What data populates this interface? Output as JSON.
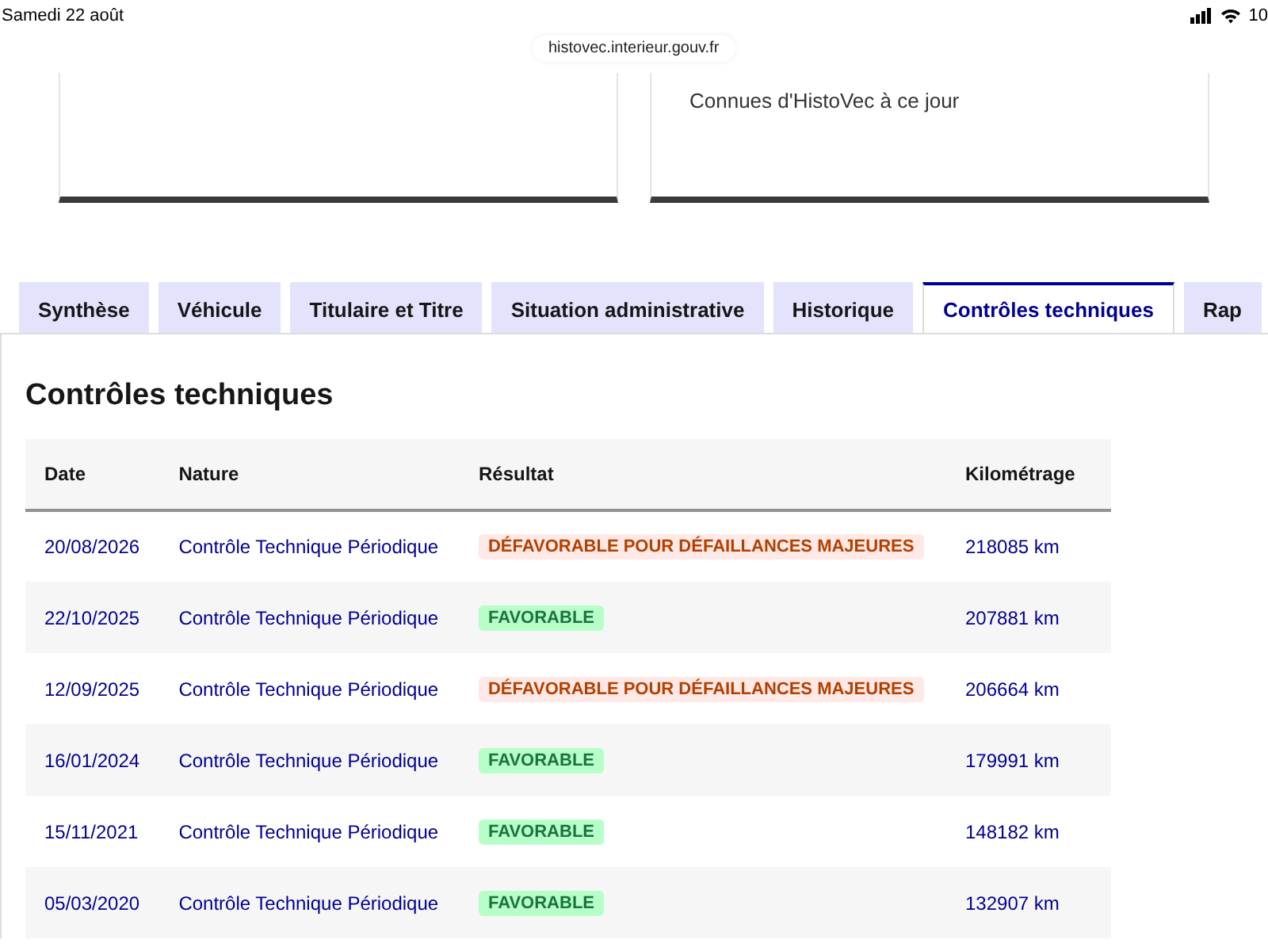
{
  "status_bar": {
    "date": "Samedi 22 août",
    "battery": "10"
  },
  "address_bar": {
    "url": "histovec.interieur.gouv.fr"
  },
  "right_card": {
    "text": "Connues d'HistoVec à ce jour"
  },
  "tabs": [
    {
      "label": "Synthèse",
      "selected": false
    },
    {
      "label": "Véhicule",
      "selected": false
    },
    {
      "label": "Titulaire et Titre",
      "selected": false
    },
    {
      "label": "Situation administrative",
      "selected": false
    },
    {
      "label": "Historique",
      "selected": false
    },
    {
      "label": "Contrôles techniques",
      "selected": true
    },
    {
      "label": "Rap",
      "selected": false
    }
  ],
  "section_title": "Contrôles techniques",
  "table": {
    "columns": [
      "Date",
      "Nature",
      "Résultat",
      "Kilométrage"
    ],
    "rows": [
      {
        "date": "20/08/2026",
        "nature": "Contrôle Technique Périodique",
        "result": {
          "kind": "error",
          "label": "DÉFAVORABLE POUR DÉFAILLANCES MAJEURES"
        },
        "mileage": "218085 km"
      },
      {
        "date": "22/10/2025",
        "nature": "Contrôle Technique Périodique",
        "result": {
          "kind": "success",
          "label": "FAVORABLE"
        },
        "mileage": "207881 km"
      },
      {
        "date": "12/09/2025",
        "nature": "Contrôle Technique Périodique",
        "result": {
          "kind": "error",
          "label": "DÉFAVORABLE POUR DÉFAILLANCES MAJEURES"
        },
        "mileage": "206664 km"
      },
      {
        "date": "16/01/2024",
        "nature": "Contrôle Technique Périodique",
        "result": {
          "kind": "success",
          "label": "FAVORABLE"
        },
        "mileage": "179991 km"
      },
      {
        "date": "15/11/2021",
        "nature": "Contrôle Technique Périodique",
        "result": {
          "kind": "success",
          "label": "FAVORABLE"
        },
        "mileage": "148182 km"
      },
      {
        "date": "05/03/2020",
        "nature": "Contrôle Technique Périodique",
        "result": {
          "kind": "success",
          "label": "FAVORABLE"
        },
        "mileage": "132907 km"
      }
    ]
  }
}
